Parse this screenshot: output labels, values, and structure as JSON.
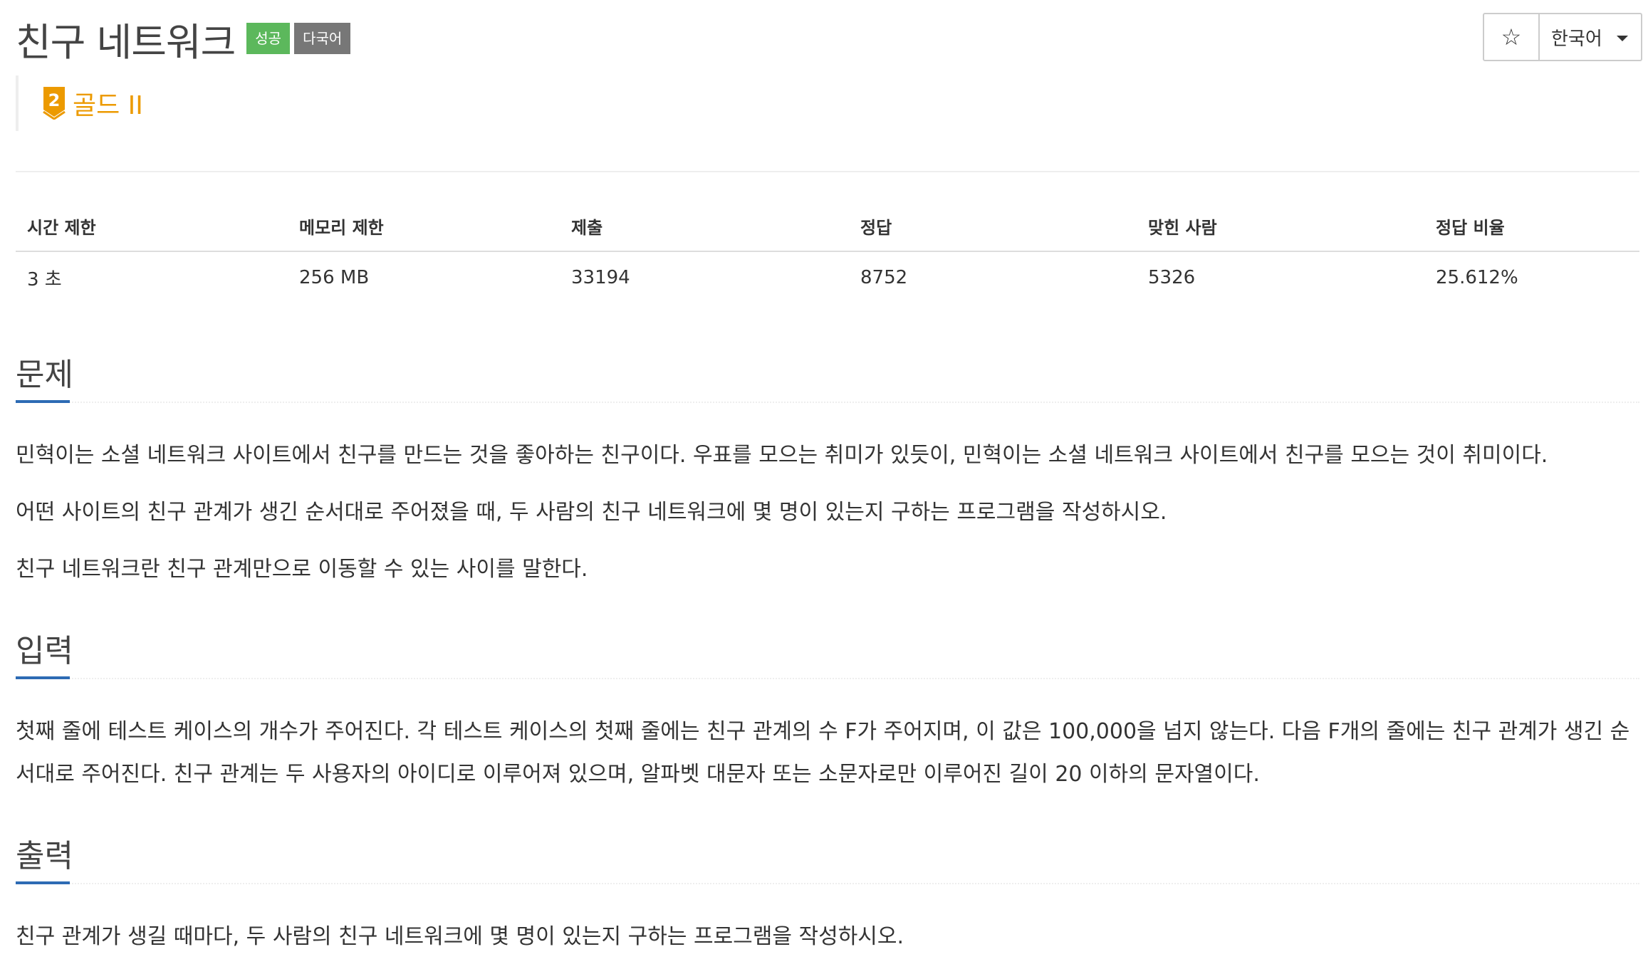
{
  "problem": {
    "title": "친구 네트워크",
    "labels": {
      "success": "성공",
      "multilang": "다국어"
    },
    "tier": {
      "number": "2",
      "name": "골드 II",
      "color": "#ec9a00"
    }
  },
  "header_actions": {
    "star_icon": "star-icon",
    "star_glyph": "☆",
    "language": "한국어"
  },
  "stats": {
    "headers": [
      "시간 제한",
      "메모리 제한",
      "제출",
      "정답",
      "맞힌 사람",
      "정답 비율"
    ],
    "values": [
      "3 초",
      "256 MB",
      "33194",
      "8752",
      "5326",
      "25.612%"
    ]
  },
  "sections": {
    "description": {
      "heading": "문제",
      "paragraphs": [
        "민혁이는 소셜 네트워크 사이트에서 친구를 만드는 것을 좋아하는 친구이다. 우표를 모으는 취미가 있듯이, 민혁이는 소셜 네트워크 사이트에서 친구를 모으는 것이 취미이다.",
        "어떤 사이트의 친구 관계가 생긴 순서대로 주어졌을 때, 두 사람의 친구 네트워크에 몇 명이 있는지 구하는 프로그램을 작성하시오.",
        "친구 네트워크란 친구 관계만으로 이동할 수 있는 사이를 말한다."
      ]
    },
    "input": {
      "heading": "입력",
      "paragraphs": [
        "첫째 줄에 테스트 케이스의 개수가 주어진다. 각 테스트 케이스의 첫째 줄에는 친구 관계의 수 F가 주어지며, 이 값은 100,000을 넘지 않는다. 다음 F개의 줄에는 친구 관계가 생긴 순서대로 주어진다. 친구 관계는 두 사용자의 아이디로 이루어져 있으며, 알파벳 대문자 또는 소문자로만 이루어진 길이 20 이하의 문자열이다."
      ]
    },
    "output": {
      "heading": "출력",
      "paragraphs": [
        "친구 관계가 생길 때마다, 두 사람의 친구 네트워크에 몇 명이 있는지 구하는 프로그램을 작성하시오."
      ]
    }
  },
  "colors": {
    "success": "#5cb85c",
    "multilang": "#777777",
    "accent": "#2d6bb4",
    "gold": "#ec9a00"
  }
}
